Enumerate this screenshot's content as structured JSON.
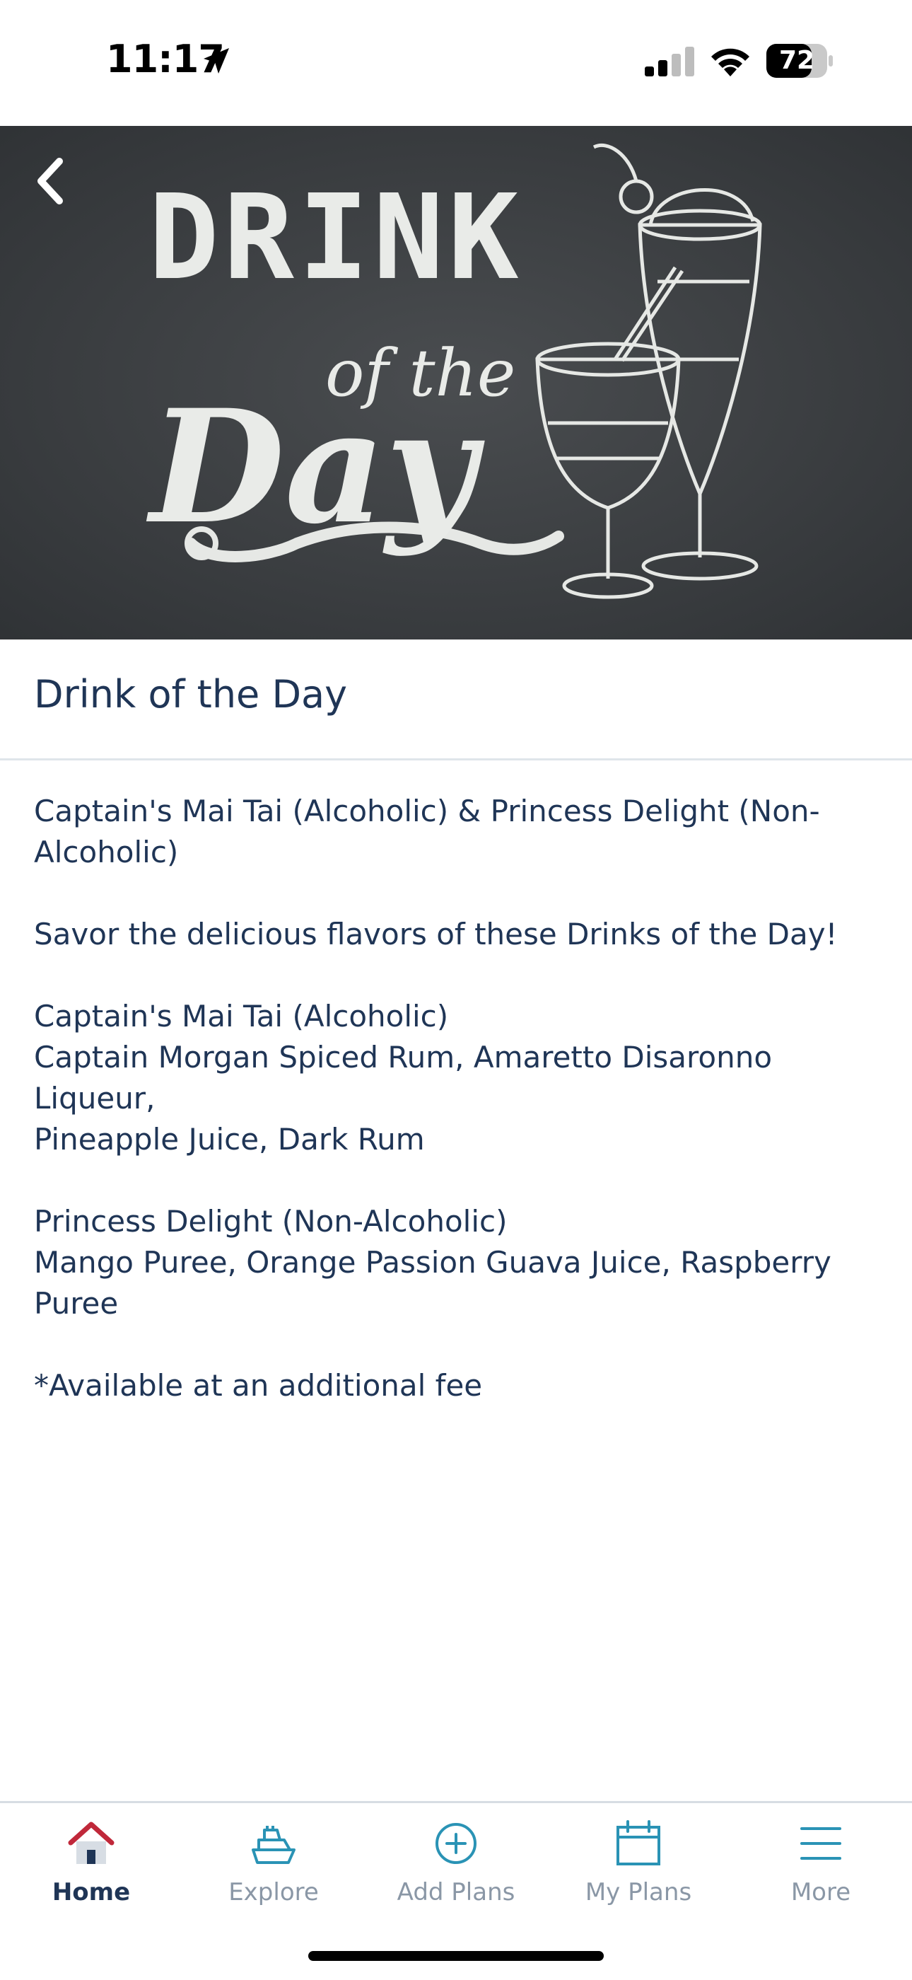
{
  "status_bar": {
    "time": "11:17",
    "battery": "72"
  },
  "hero": {
    "title": "DRINK",
    "subtitle": "of the",
    "day": "Day"
  },
  "page": {
    "title": "Drink of the Day",
    "body": {
      "intro_line1": "Captain's Mai Tai (Alcoholic) & Princess Delight (Non-",
      "intro_line2": "Alcoholic)",
      "tagline": "Savor the delicious flavors of these Drinks of the Day!",
      "drink1_name": "Captain's Mai Tai (Alcoholic)",
      "drink1_ingredients_line1": "Captain Morgan Spiced Rum, Amaretto Disaronno Liqueur,",
      "drink1_ingredients_line2": "Pineapple Juice, Dark Rum",
      "drink2_name": "Princess Delight (Non-Alcoholic)",
      "drink2_ingredients": "Mango Puree, Orange Passion Guava Juice, Raspberry Puree",
      "footnote": "*Available at an additional fee"
    }
  },
  "tab_bar": {
    "items": [
      {
        "label": "Home",
        "icon": "home-icon",
        "active": true
      },
      {
        "label": "Explore",
        "icon": "ship-icon",
        "active": false
      },
      {
        "label": "Add Plans",
        "icon": "plus-circle-icon",
        "active": false
      },
      {
        "label": "My Plans",
        "icon": "calendar-icon",
        "active": false
      },
      {
        "label": "More",
        "icon": "menu-icon",
        "active": false
      }
    ]
  },
  "colors": {
    "text": "#1f3556",
    "inactive_tab": "#8a97a6",
    "accent_teal": "#2a93b5",
    "home_red": "#c0283a",
    "chalkboard": "#3a3d40"
  }
}
